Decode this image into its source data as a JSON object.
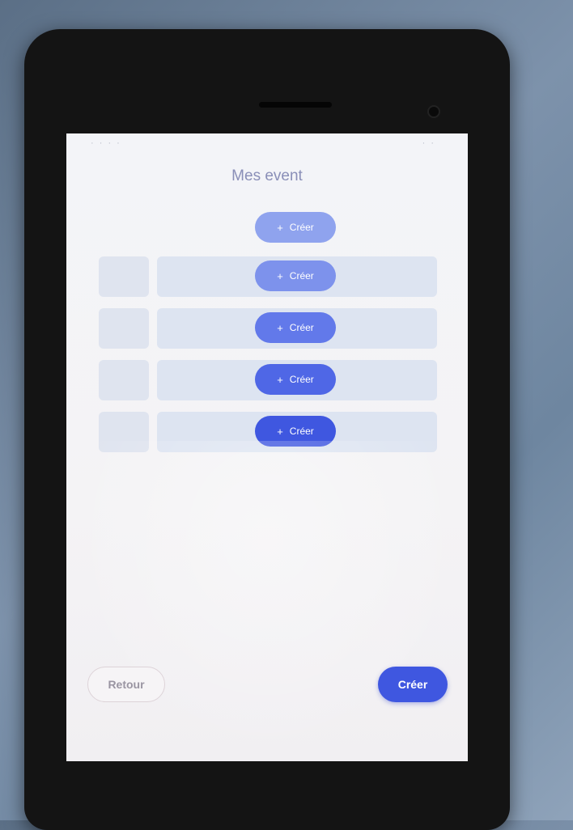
{
  "colors": {
    "primary": "#3f57e0",
    "row_buttons": [
      "#8fa3ee",
      "#7d92ec",
      "#6279ea",
      "#4f67e6",
      "#3f57e0"
    ]
  },
  "status_bar": {
    "left": "· · · ·",
    "right": "· ·"
  },
  "page": {
    "title": "Mes event"
  },
  "rows": [
    {
      "button_icon": "plus-icon",
      "button_label": "Créer"
    },
    {
      "button_icon": "plus-icon",
      "button_label": "Créer"
    },
    {
      "button_icon": "plus-icon",
      "button_label": "Créer"
    },
    {
      "button_icon": "plus-icon",
      "button_label": "Créer"
    },
    {
      "button_icon": "plus-icon",
      "button_label": "Créer"
    }
  ],
  "footer": {
    "back_label": "Retour",
    "create_label": "Créer"
  }
}
